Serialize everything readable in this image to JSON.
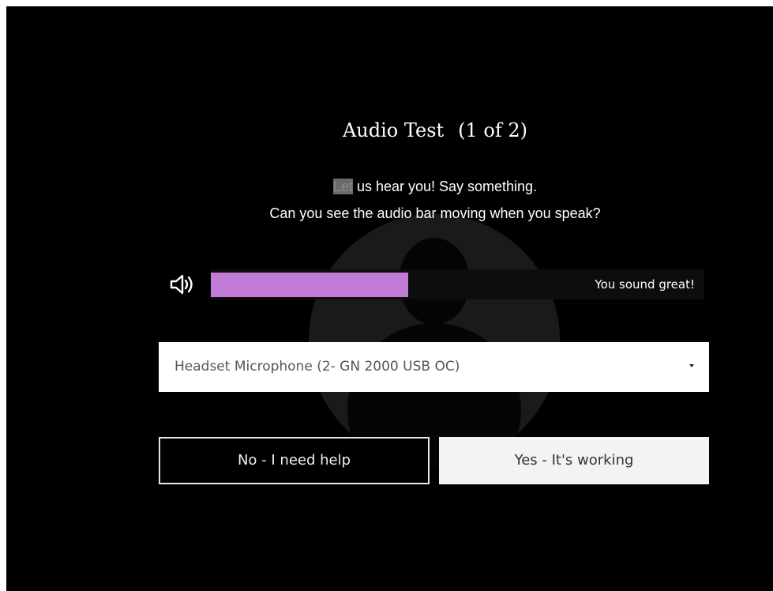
{
  "dialog": {
    "title": "Audio Test",
    "step": "(1 of 2)",
    "message_highlight": "Let",
    "message_line1_rest": " us hear you! Say something.",
    "message_line2": "Can you see the audio bar moving when you speak?"
  },
  "meter": {
    "level_fraction": 0.4,
    "fill_color": "#c17ad6",
    "status": "You sound great!",
    "icon": "speaker-icon"
  },
  "microphone": {
    "selected": "Headset Microphone (2- GN 2000 USB OC)",
    "icon": "chevron-down-icon"
  },
  "buttons": {
    "no": "No - I need help",
    "yes": "Yes - It's working"
  }
}
